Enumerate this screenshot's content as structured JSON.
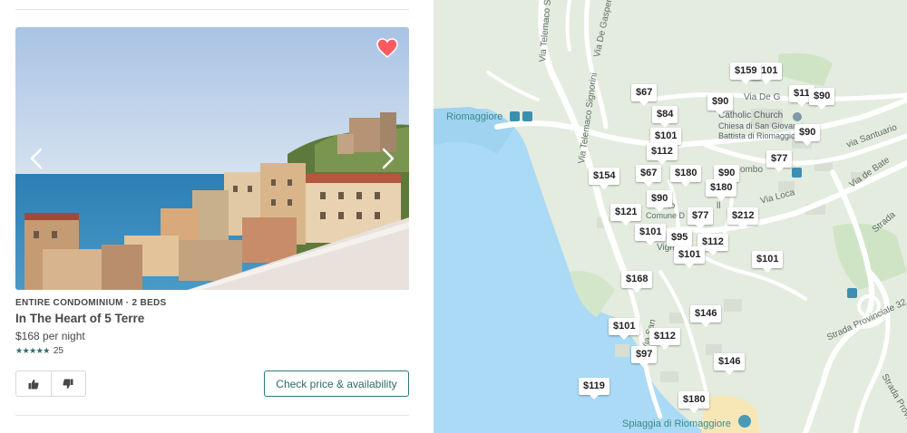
{
  "listing": {
    "type_label": "ENTIRE CONDOMINIUM · 2 BEDS",
    "title": "In The Heart of 5 Terre",
    "price": "$168 per night",
    "stars": "★★★★★",
    "rating": 4.5,
    "review_count": "25",
    "favorited": true,
    "check_button_label": "Check price & availability"
  },
  "colors": {
    "accent": "#2f6b6b",
    "heart": "#ff5a5f",
    "map_land": "#e4ecdf",
    "map_water": "#aadaf5",
    "map_road": "#ffffff"
  },
  "map": {
    "labels": {
      "riomaggiore": "Riomaggiore",
      "church": "Catholic Church",
      "church_sub1": "Chiesa di San Giovanni",
      "church_sub2": "Battista di Riomaggiore",
      "spiaggia": "Spiaggia di Riomaggiore",
      "via_santuario": "via Santuario",
      "via_de_gasperi": "Via De Gasperi",
      "via_telemaco_signorini": "Via Telemaco Signorini",
      "via_telemaco": "Via Telemaco Si",
      "via_de_g": "Via De G",
      "via_de_bate": "Via de Bate",
      "strada_provinciale": "Strada Provinciale 32",
      "strada": "Strada",
      "strada_provincia": "Strada Provincia",
      "via_loca": "Via Loca",
      "lombo": "ombo",
      "comune": "Comune D",
      "vign": "Vign",
      "via_san": "Via San",
      "to": "to",
      "ll": "ll"
    },
    "pins": [
      "$159",
      "$67",
      "$90",
      "$11",
      "$90",
      "$84",
      "$101",
      "$90",
      "$112",
      "$77",
      "$154",
      "$67",
      "$180",
      "$90",
      "$180",
      "$90",
      "$121",
      "$77",
      "$212",
      "$101",
      "$95",
      "$112",
      "$101",
      "$101",
      "$168",
      "$146",
      "$101",
      "$112",
      "$97",
      "$146",
      "$119",
      "$180"
    ]
  }
}
